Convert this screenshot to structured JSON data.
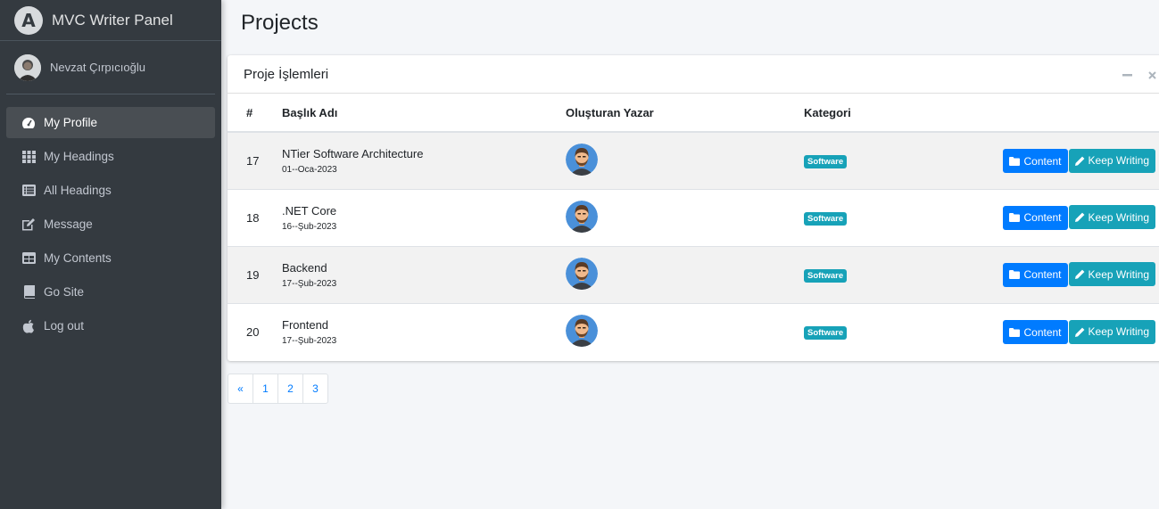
{
  "brand": {
    "title": "MVC Writer Panel",
    "logo_letter": "A"
  },
  "user": {
    "name": "Nevzat Çırpıcıoğlu"
  },
  "sidebar": {
    "items": [
      {
        "label": "My Profile",
        "icon": "dashboard-icon",
        "active": true
      },
      {
        "label": "My Headings",
        "icon": "grid-icon"
      },
      {
        "label": "All Headings",
        "icon": "list-icon"
      },
      {
        "label": "Message",
        "icon": "edit-icon"
      },
      {
        "label": "My Contents",
        "icon": "table-icon"
      },
      {
        "label": "Go Site",
        "icon": "book-icon"
      },
      {
        "label": "Log out",
        "icon": "apple-icon"
      }
    ]
  },
  "page": {
    "title": "Projects"
  },
  "card": {
    "title": "Proje İşlemleri"
  },
  "table": {
    "headers": [
      "#",
      "Başlık Adı",
      "Oluşturan Yazar",
      "Kategori"
    ],
    "rows": [
      {
        "id": "17",
        "title": "NTier Software Architecture",
        "date": "01--Oca-2023",
        "category": "Software"
      },
      {
        "id": "18",
        "title": ".NET Core",
        "date": "16--Şub-2023",
        "category": "Software"
      },
      {
        "id": "19",
        "title": "Backend",
        "date": "17--Şub-2023",
        "category": "Software"
      },
      {
        "id": "20",
        "title": "Frontend",
        "date": "17--Şub-2023",
        "category": "Software"
      }
    ],
    "content_label": "Content",
    "keep_writing_label": "Keep Writing"
  },
  "pagination": {
    "prev": "«",
    "pages": [
      "1",
      "2",
      "3"
    ]
  },
  "colors": {
    "sidebar": "#343a40",
    "primary": "#007bff",
    "info": "#17a2b8"
  }
}
